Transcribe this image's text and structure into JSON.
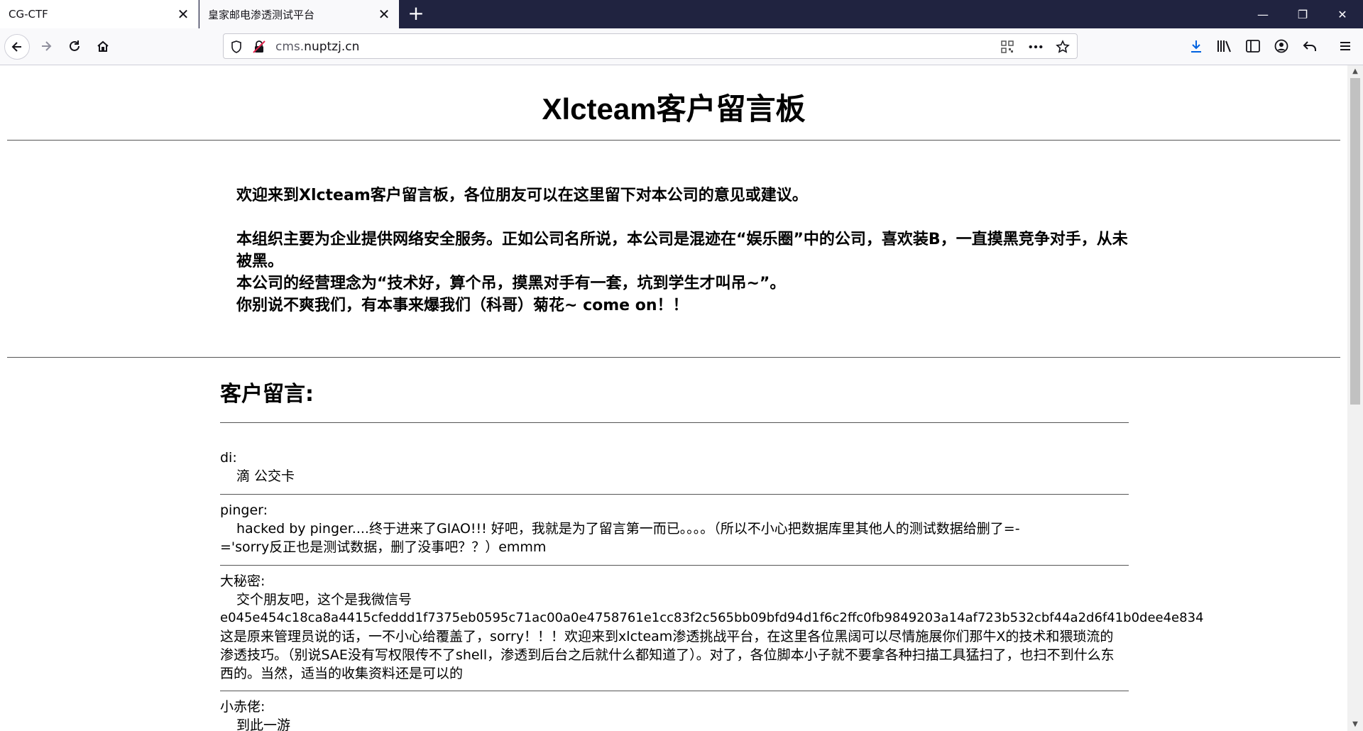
{
  "tabs": [
    {
      "label": "CG-CTF",
      "active": false
    },
    {
      "label": "皇家邮电渗透测试平台",
      "active": true
    }
  ],
  "window_controls": {
    "minimize": "—",
    "restore": "❐",
    "close": "✕"
  },
  "url": {
    "host_prefix": "cms.",
    "host_main": "nuptzj.cn"
  },
  "page": {
    "title": "Xlcteam客户留言板",
    "intro_lines": [
      "欢迎来到Xlcteam客户留言板，各位朋友可以在这里留下对本公司的意见或建议。",
      "",
      "本组织主要为企业提供网络安全服务。正如公司名所说，本公司是混迹在“娱乐圈”中的公司，喜欢装B，一直摸黑竞争对手，从未被黑。",
      "本公司的经营理念为“技术好，算个吊，摸黑对手有一套，坑到学生才叫吊~”。",
      "你别说不爽我们，有本事来爆我们（科哥）菊花~ come on！！"
    ],
    "messages_heading": "客户留言:",
    "messages": [
      {
        "author": "di:",
        "body": "滴 公交卡"
      },
      {
        "author": "pinger:",
        "body": "hacked by pinger....终于进来了GIAO!!! 好吧，我就是为了留言第一而已。。。。（所以不小心把数据库里其他人的测试数据给删了=-='sorry反正也是测试数据，删了没事吧？？）emmm"
      },
      {
        "author": "大秘密:",
        "body": "交个朋友吧，这个是我微信号",
        "body_extra": "e045e454c18ca8a4415cfeddd1f7375eb0595c71ac00a0e4758761e1cc83f2c565bb09bfd94d1f6c2ffc0fb9849203a14af723b532cbf44a2d6f41b0dee4e834",
        "body_tail": "这是原来管理员说的话，一不小心给覆盖了，sorry！！！欢迎来到xlcteam渗透挑战平台，在这里各位黑阔可以尽情施展你们那牛X的技术和猥琐流的渗透技巧。（别说SAE没有写权限传不了shell，渗透到后台之后就什么都知道了）。对了，各位脚本小子就不要拿各种扫描工具猛扫了，也扫不到什么东西的。当然，适当的收集资料还是可以的"
      },
      {
        "author": "小赤佬:",
        "body": "到此一游"
      }
    ]
  }
}
